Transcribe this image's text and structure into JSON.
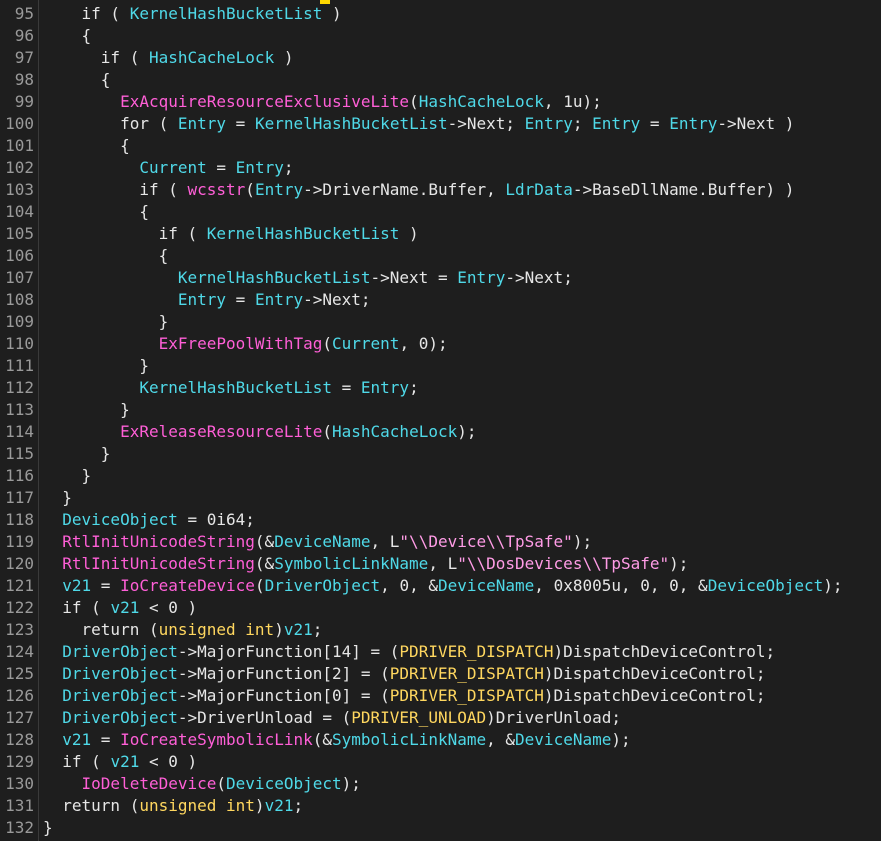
{
  "editor": {
    "lines": [
      {
        "no": "95",
        "tokens": [
          [
            "p",
            "    "
          ],
          [
            "kw",
            "if"
          ],
          [
            "p",
            " ( "
          ],
          [
            "id",
            "KernelHashBucketList"
          ],
          [
            "p",
            " )"
          ]
        ]
      },
      {
        "no": "96",
        "tokens": [
          [
            "p",
            "    {"
          ]
        ]
      },
      {
        "no": "97",
        "tokens": [
          [
            "p",
            "      "
          ],
          [
            "kw",
            "if"
          ],
          [
            "p",
            " ( "
          ],
          [
            "id",
            "HashCacheLock"
          ],
          [
            "p",
            " )"
          ]
        ]
      },
      {
        "no": "98",
        "tokens": [
          [
            "p",
            "      {"
          ]
        ]
      },
      {
        "no": "99",
        "tokens": [
          [
            "p",
            "        "
          ],
          [
            "fn",
            "ExAcquireResourceExclusiveLite"
          ],
          [
            "p",
            "("
          ],
          [
            "id",
            "HashCacheLock"
          ],
          [
            "p",
            ", 1u);"
          ]
        ]
      },
      {
        "no": "100",
        "tokens": [
          [
            "p",
            "        "
          ],
          [
            "kw",
            "for"
          ],
          [
            "p",
            " ( "
          ],
          [
            "id",
            "Entry"
          ],
          [
            "p",
            " = "
          ],
          [
            "id",
            "KernelHashBucketList"
          ],
          [
            "p",
            "->Next; "
          ],
          [
            "id",
            "Entry"
          ],
          [
            "p",
            "; "
          ],
          [
            "id",
            "Entry"
          ],
          [
            "p",
            " = "
          ],
          [
            "id",
            "Entry"
          ],
          [
            "p",
            "->Next )"
          ]
        ]
      },
      {
        "no": "101",
        "tokens": [
          [
            "p",
            "        {"
          ]
        ]
      },
      {
        "no": "102",
        "tokens": [
          [
            "p",
            "          "
          ],
          [
            "id",
            "Current"
          ],
          [
            "p",
            " = "
          ],
          [
            "id",
            "Entry"
          ],
          [
            "p",
            ";"
          ]
        ]
      },
      {
        "no": "103",
        "tokens": [
          [
            "p",
            "          "
          ],
          [
            "kw",
            "if"
          ],
          [
            "p",
            " ( "
          ],
          [
            "fn",
            "wcsstr"
          ],
          [
            "p",
            "("
          ],
          [
            "id",
            "Entry"
          ],
          [
            "p",
            "->DriverName.Buffer, "
          ],
          [
            "id",
            "LdrData"
          ],
          [
            "p",
            "->BaseDllName.Buffer) )"
          ]
        ]
      },
      {
        "no": "104",
        "tokens": [
          [
            "p",
            "          {"
          ]
        ]
      },
      {
        "no": "105",
        "tokens": [
          [
            "p",
            "            "
          ],
          [
            "kw",
            "if"
          ],
          [
            "p",
            " ( "
          ],
          [
            "id",
            "KernelHashBucketList"
          ],
          [
            "p",
            " )"
          ]
        ]
      },
      {
        "no": "106",
        "tokens": [
          [
            "p",
            "            {"
          ]
        ]
      },
      {
        "no": "107",
        "tokens": [
          [
            "p",
            "              "
          ],
          [
            "id",
            "KernelHashBucketList"
          ],
          [
            "p",
            "->Next = "
          ],
          [
            "id",
            "Entry"
          ],
          [
            "p",
            "->Next;"
          ]
        ]
      },
      {
        "no": "108",
        "tokens": [
          [
            "p",
            "              "
          ],
          [
            "id",
            "Entry"
          ],
          [
            "p",
            " = "
          ],
          [
            "id",
            "Entry"
          ],
          [
            "p",
            "->Next;"
          ]
        ]
      },
      {
        "no": "109",
        "tokens": [
          [
            "p",
            "            }"
          ]
        ]
      },
      {
        "no": "110",
        "tokens": [
          [
            "p",
            "            "
          ],
          [
            "fn",
            "ExFreePoolWithTag"
          ],
          [
            "p",
            "("
          ],
          [
            "id",
            "Current"
          ],
          [
            "p",
            ", 0);"
          ]
        ]
      },
      {
        "no": "111",
        "tokens": [
          [
            "p",
            "          }"
          ]
        ]
      },
      {
        "no": "112",
        "tokens": [
          [
            "p",
            "          "
          ],
          [
            "id",
            "KernelHashBucketList"
          ],
          [
            "p",
            " = "
          ],
          [
            "id",
            "Entry"
          ],
          [
            "p",
            ";"
          ]
        ]
      },
      {
        "no": "113",
        "tokens": [
          [
            "p",
            "        }"
          ]
        ]
      },
      {
        "no": "114",
        "tokens": [
          [
            "p",
            "        "
          ],
          [
            "fn",
            "ExReleaseResourceLite"
          ],
          [
            "p",
            "("
          ],
          [
            "id",
            "HashCacheLock"
          ],
          [
            "p",
            ");"
          ]
        ]
      },
      {
        "no": "115",
        "tokens": [
          [
            "p",
            "      }"
          ]
        ]
      },
      {
        "no": "116",
        "tokens": [
          [
            "p",
            "    }"
          ]
        ]
      },
      {
        "no": "117",
        "tokens": [
          [
            "p",
            "  }"
          ]
        ]
      },
      {
        "no": "118",
        "tokens": [
          [
            "p",
            "  "
          ],
          [
            "id",
            "DeviceObject"
          ],
          [
            "p",
            " = 0i64;"
          ]
        ]
      },
      {
        "no": "119",
        "tokens": [
          [
            "p",
            "  "
          ],
          [
            "fn",
            "RtlInitUnicodeString"
          ],
          [
            "p",
            "(&"
          ],
          [
            "id",
            "DeviceName"
          ],
          [
            "p",
            ", L"
          ],
          [
            "str",
            "\"\\\\Device\\\\TpSafe\""
          ],
          [
            "p",
            ");"
          ]
        ]
      },
      {
        "no": "120",
        "tokens": [
          [
            "p",
            "  "
          ],
          [
            "fn",
            "RtlInitUnicodeString"
          ],
          [
            "p",
            "(&"
          ],
          [
            "id",
            "SymbolicLinkName"
          ],
          [
            "p",
            ", L"
          ],
          [
            "str",
            "\"\\\\DosDevices\\\\TpSafe\""
          ],
          [
            "p",
            ");"
          ]
        ]
      },
      {
        "no": "121",
        "tokens": [
          [
            "p",
            "  "
          ],
          [
            "id",
            "v21"
          ],
          [
            "p",
            " = "
          ],
          [
            "fn",
            "IoCreateDevice"
          ],
          [
            "p",
            "("
          ],
          [
            "id",
            "DriverObject"
          ],
          [
            "p",
            ", 0, &"
          ],
          [
            "id",
            "DeviceName"
          ],
          [
            "p",
            ", 0x8005u, 0, 0, &"
          ],
          [
            "id",
            "DeviceObject"
          ],
          [
            "p",
            ");"
          ]
        ]
      },
      {
        "no": "122",
        "tokens": [
          [
            "p",
            "  "
          ],
          [
            "kw",
            "if"
          ],
          [
            "p",
            " ( "
          ],
          [
            "id",
            "v21"
          ],
          [
            "p",
            " < 0 )"
          ]
        ]
      },
      {
        "no": "123",
        "tokens": [
          [
            "p",
            "    "
          ],
          [
            "kw",
            "return"
          ],
          [
            "p",
            " ("
          ],
          [
            "ty",
            "unsigned int"
          ],
          [
            "p",
            ")"
          ],
          [
            "id",
            "v21"
          ],
          [
            "p",
            ";"
          ]
        ]
      },
      {
        "no": "124",
        "tokens": [
          [
            "p",
            "  "
          ],
          [
            "id",
            "DriverObject"
          ],
          [
            "p",
            "->MajorFunction[14] = ("
          ],
          [
            "ty",
            "PDRIVER_DISPATCH"
          ],
          [
            "p",
            ")DispatchDeviceControl;"
          ]
        ]
      },
      {
        "no": "125",
        "tokens": [
          [
            "p",
            "  "
          ],
          [
            "id",
            "DriverObject"
          ],
          [
            "p",
            "->MajorFunction[2] = ("
          ],
          [
            "ty",
            "PDRIVER_DISPATCH"
          ],
          [
            "p",
            ")DispatchDeviceControl;"
          ]
        ]
      },
      {
        "no": "126",
        "tokens": [
          [
            "p",
            "  "
          ],
          [
            "id",
            "DriverObject"
          ],
          [
            "p",
            "->MajorFunction[0] = ("
          ],
          [
            "ty",
            "PDRIVER_DISPATCH"
          ],
          [
            "p",
            ")DispatchDeviceControl;"
          ]
        ]
      },
      {
        "no": "127",
        "tokens": [
          [
            "p",
            "  "
          ],
          [
            "id",
            "DriverObject"
          ],
          [
            "p",
            "->DriverUnload = ("
          ],
          [
            "ty",
            "PDRIVER_UNLOAD"
          ],
          [
            "p",
            ")DriverUnload;"
          ]
        ]
      },
      {
        "no": "128",
        "tokens": [
          [
            "p",
            "  "
          ],
          [
            "id",
            "v21"
          ],
          [
            "p",
            " = "
          ],
          [
            "fn",
            "IoCreateSymbolicLink"
          ],
          [
            "p",
            "(&"
          ],
          [
            "id",
            "SymbolicLinkName"
          ],
          [
            "p",
            ", &"
          ],
          [
            "id",
            "DeviceName"
          ],
          [
            "p",
            ");"
          ]
        ]
      },
      {
        "no": "129",
        "tokens": [
          [
            "p",
            "  "
          ],
          [
            "kw",
            "if"
          ],
          [
            "p",
            " ( "
          ],
          [
            "id",
            "v21"
          ],
          [
            "p",
            " < 0 )"
          ]
        ]
      },
      {
        "no": "130",
        "tokens": [
          [
            "p",
            "    "
          ],
          [
            "fn",
            "IoDeleteDevice"
          ],
          [
            "p",
            "("
          ],
          [
            "id",
            "DeviceObject"
          ],
          [
            "p",
            ");"
          ]
        ]
      },
      {
        "no": "131",
        "tokens": [
          [
            "p",
            "  "
          ],
          [
            "kw",
            "return"
          ],
          [
            "p",
            " ("
          ],
          [
            "ty",
            "unsigned int"
          ],
          [
            "p",
            ")"
          ],
          [
            "id",
            "v21"
          ],
          [
            "p",
            ";"
          ]
        ]
      },
      {
        "no": "132",
        "tokens": [
          [
            "p",
            "}"
          ]
        ]
      }
    ]
  },
  "colors": {
    "background": "#1e1e1e",
    "identifier": "#4fd9e8",
    "function": "#ff5fd7",
    "type": "#ffd75f",
    "string": "#ff9ce6",
    "plain": "#e6e6e6",
    "line_number": "#9a9a9a"
  }
}
